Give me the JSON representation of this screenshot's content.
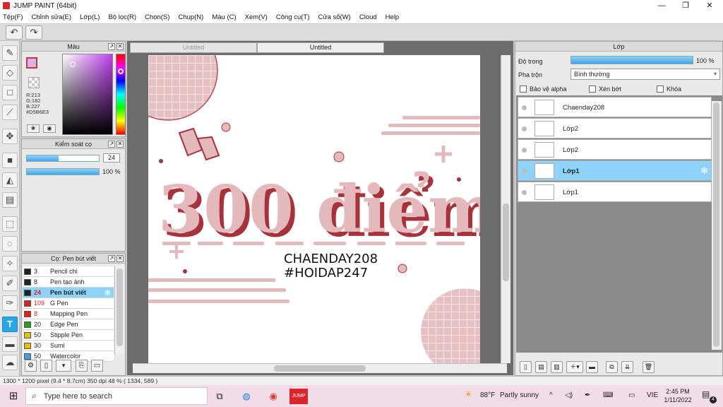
{
  "window": {
    "title": "JUMP PAINT (64bit)",
    "minimize": "—",
    "restore": "❐",
    "close": "✕"
  },
  "menu": [
    "Tệp(F)",
    "Chỉnh sửa(E)",
    "Lớp(L)",
    "Bộ lọc(R)",
    "Chọn(S)",
    "Chụp(N)",
    "Màu (C)",
    "Xem(V)",
    "Công cụ(T)",
    "Cửa sổ(W)",
    "Cloud",
    "Help"
  ],
  "toolbar": {
    "undo_icon": "↶",
    "redo_icon": "↷"
  },
  "color_panel": {
    "title": "Màu",
    "r": "R:213",
    "g": "G:182",
    "b": "B:227",
    "hex": "#D5B6E3",
    "fg_color": "#d5b6e3"
  },
  "brush_control": {
    "title": "Kiểm soát cọ",
    "size_value": "24",
    "size_level": 0.44,
    "opacity_label": "100 %",
    "opacity_level": 1.0
  },
  "brush_list": {
    "title": "Cọ: Pen bút viết",
    "items": [
      {
        "size": "3",
        "name": "Pencil chì",
        "color": "#222222"
      },
      {
        "size": "8",
        "name": "Pen tạo ảnh",
        "color": "#222222"
      },
      {
        "size": "24",
        "name": "Pen bút viết",
        "color": "#222222",
        "selected": true
      },
      {
        "size": "109",
        "name": "G Pen",
        "color": "#e02020"
      },
      {
        "size": "8",
        "name": "Mapping Pen",
        "color": "#e02020"
      },
      {
        "size": "20",
        "name": "Edge Pen",
        "color": "#20a020"
      },
      {
        "size": "50",
        "name": "Stipple Pen",
        "color": "#e0c000"
      },
      {
        "size": "30",
        "name": "Sumi",
        "color": "#e0c000"
      },
      {
        "size": "50",
        "name": "Watercolor",
        "color": "#40a0e0"
      }
    ]
  },
  "tabs": [
    {
      "label": "Untitled",
      "active": false
    },
    {
      "label": "Untitled",
      "active": true
    }
  ],
  "artwork": {
    "main_text": "300 điểm",
    "line1": "CHAENDAY208",
    "line2": "#HOIDAP247",
    "pink": "#e4b9bc",
    "shadow": "#a8323c"
  },
  "layers_panel": {
    "title": "Lớp",
    "opacity_label": "Độ trong",
    "opacity_value": "100 %",
    "blend_label": "Pha trộn",
    "blend_value": "Bình thường",
    "protect_alpha": "Bảo vệ alpha",
    "clip": "Xén bớt",
    "lock": "Khóa",
    "layers": [
      {
        "name": "Chaenday208",
        "selected": false
      },
      {
        "name": "Lớp2",
        "selected": false
      },
      {
        "name": "Lớp2",
        "selected": false
      },
      {
        "name": "Lớp1",
        "selected": true
      },
      {
        "name": "Lớp1",
        "selected": false
      }
    ]
  },
  "status": {
    "text": "1300 * 1200 pixel  (9.4 * 8.7cm)  350 dpi  48 %  ( 1334, 589 )"
  },
  "taskbar": {
    "search_placeholder": "Type here to search",
    "weather_temp": "88°F",
    "weather_desc": "Partly sunny",
    "lang": "VIE",
    "time": "2:45 PM",
    "date": "1/11/2022",
    "notif_count": "4"
  }
}
